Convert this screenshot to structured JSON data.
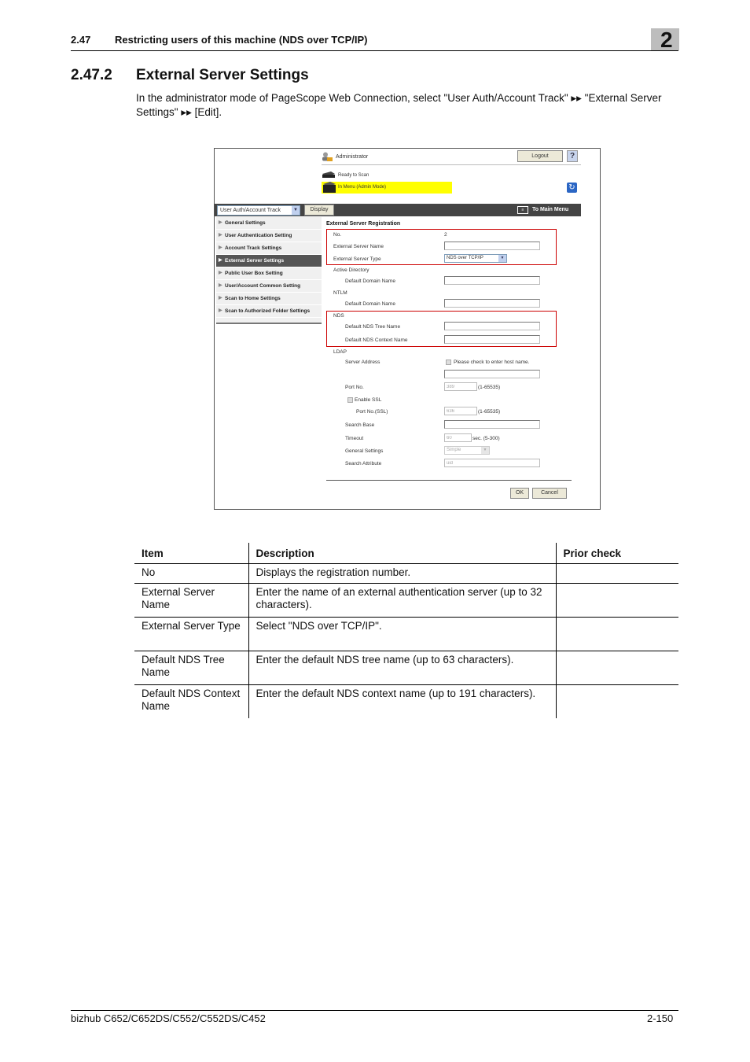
{
  "header": {
    "section_number": "2.47",
    "section_title": "Restricting users of this machine (NDS over TCP/IP)",
    "chapter": "2"
  },
  "section": {
    "number": "2.47.2",
    "title": "External Server Settings",
    "intro": "In the administrator mode of PageScope Web Connection, select \"User Auth/Account Track\" ▸▸ \"External Server Settings\" ▸▸ [Edit]."
  },
  "screenshot": {
    "user": "Administrator",
    "logout_label": "Logout",
    "help_label": "?",
    "status_ready": "Ready to Scan",
    "status_menu": "In Menu (Admin Mode)",
    "highlight_color": "#ffff00",
    "category_select": "User Auth/Account Track",
    "display_label": "Display",
    "main_menu_label": "To Main Menu",
    "sidebar": [
      {
        "label": "General Settings",
        "active": false
      },
      {
        "label": "User Authentication Setting",
        "active": false
      },
      {
        "label": "Account Track Settings",
        "active": false
      },
      {
        "label": "External Server Settings",
        "active": true
      },
      {
        "label": "Public User Box Setting",
        "active": false
      },
      {
        "label": "User/Account Common Setting",
        "active": false
      },
      {
        "label": "Scan to Home Settings",
        "active": false
      },
      {
        "label": "Scan to Authorized Folder Settings",
        "active": false
      }
    ],
    "form": {
      "title": "External Server Registration",
      "no_label": "No.",
      "no_value": "2",
      "server_name_label": "External Server Name",
      "server_name_value": "",
      "server_type_label": "External Server Type",
      "server_type_value": "NDS over TCP/IP",
      "active_directory_label": "Active Directory",
      "ad_domain_label": "Default Domain Name",
      "ad_domain_value": "",
      "ntlm_label": "NTLM",
      "ntlm_domain_label": "Default Domain Name",
      "ntlm_domain_value": "",
      "nds_label": "NDS",
      "nds_tree_label": "Default NDS Tree Name",
      "nds_tree_value": "",
      "nds_context_label": "Default NDS Context Name",
      "nds_context_value": "",
      "ldap_label": "LDAP",
      "server_address_label": "Server Address",
      "host_name_check_label": "Please check to enter host name.",
      "server_address_value": "",
      "port_label": "Port No.",
      "port_value": "389",
      "port_range": "(1-65535)",
      "enable_ssl_label": "Enable SSL",
      "port_ssl_label": "Port No.(SSL)",
      "port_ssl_value": "636",
      "port_ssl_range": "(1-65535)",
      "search_base_label": "Search Base",
      "search_base_value": "",
      "timeout_label": "Timeout",
      "timeout_value": "60",
      "timeout_unit": "sec. (5-300)",
      "general_settings_label": "General Settings",
      "general_settings_value": "Simple",
      "search_attribute_label": "Search Attribute",
      "search_attribute_value": "uid",
      "ok_label": "OK",
      "cancel_label": "Cancel",
      "callout_color": "#cc0000"
    }
  },
  "table": {
    "headers": [
      "Item",
      "Description",
      "Prior check"
    ],
    "rows": [
      {
        "item": "No",
        "description": "Displays the registration number.",
        "prior": ""
      },
      {
        "item": "External Server Name",
        "description": "Enter the name of an external authentication server (up to 32 characters).",
        "prior": ""
      },
      {
        "item": "External Server Type",
        "description": "Select \"NDS over TCP/IP\".",
        "prior": ""
      },
      {
        "item": "Default NDS Tree Name",
        "description": "Enter the default NDS tree name (up to 63 characters).",
        "prior": ""
      },
      {
        "item": "Default NDS Context Name",
        "description": "Enter the default NDS context name (up to 191 characters).",
        "prior": ""
      }
    ]
  },
  "footer": {
    "product": "bizhub C652/C652DS/C552/C552DS/C452",
    "page": "2-150"
  }
}
